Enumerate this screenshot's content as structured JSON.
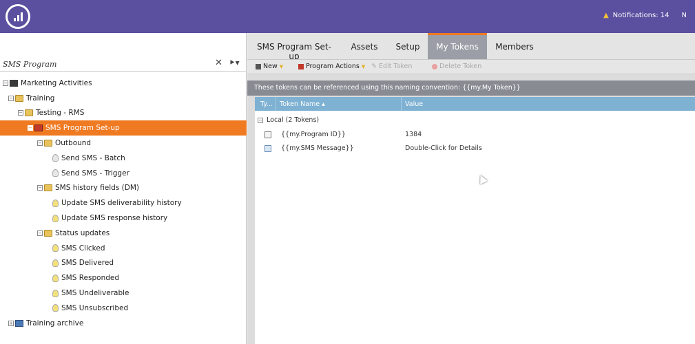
{
  "header": {
    "notifications_label": "Notifications: 14",
    "user_initial": "N",
    "brand_color": "#5b4fa0"
  },
  "left_panel": {
    "search": {
      "value": "SMS Program",
      "clear_glyph": "✕",
      "filter_glyph": "⯈▾"
    },
    "tree": [
      {
        "label": "Marketing Activities",
        "level": 0,
        "icon": "marketing-activities-icon",
        "expander": "−"
      },
      {
        "label": "Training",
        "level": 1,
        "icon": "folder-icon",
        "expander": "−"
      },
      {
        "label": "Testing - RMS",
        "level": 2,
        "icon": "folder-icon",
        "expander": "−"
      },
      {
        "label": "SMS Program Set-up",
        "level": 3,
        "icon": "program-icon",
        "expander": "−",
        "selected": true
      },
      {
        "label": "Outbound",
        "level": 4,
        "icon": "folder-icon",
        "expander": "−"
      },
      {
        "label": "Send SMS - Batch",
        "level": 5,
        "icon": "campaign-bulb-icon"
      },
      {
        "label": "Send SMS - Trigger",
        "level": 5,
        "icon": "campaign-bulb-icon"
      },
      {
        "label": "SMS history fields (DM)",
        "level": 4,
        "icon": "folder-icon",
        "expander": "−"
      },
      {
        "label": "Update SMS deliverability history",
        "level": 5,
        "icon": "campaign-bulb-icon"
      },
      {
        "label": "Update SMS response history",
        "level": 5,
        "icon": "campaign-bulb-icon"
      },
      {
        "label": "Status updates",
        "level": 4,
        "icon": "folder-icon",
        "expander": "−"
      },
      {
        "label": "SMS Clicked",
        "level": 5,
        "icon": "campaign-bulb-icon"
      },
      {
        "label": "SMS Delivered",
        "level": 5,
        "icon": "campaign-bulb-icon"
      },
      {
        "label": "SMS Responded",
        "level": 5,
        "icon": "campaign-bulb-icon"
      },
      {
        "label": "SMS Undeliverable",
        "level": 5,
        "icon": "campaign-bulb-icon"
      },
      {
        "label": "SMS Unsubscribed",
        "level": 5,
        "icon": "campaign-bulb-icon"
      },
      {
        "label": "Training archive",
        "level": 1,
        "icon": "archive-icon",
        "expander": "+"
      }
    ]
  },
  "tabs": [
    {
      "label": "SMS Program Set-up",
      "active": false
    },
    {
      "label": "Assets",
      "active": false
    },
    {
      "label": "Setup",
      "active": false
    },
    {
      "label": "My Tokens",
      "active": true
    },
    {
      "label": "Members",
      "active": false
    }
  ],
  "toolbar": {
    "new_label": "New",
    "program_actions_label": "Program Actions",
    "edit_token_label": "Edit Token",
    "delete_token_label": "Delete Token"
  },
  "info_bar": {
    "text": "These tokens can be referenced using this naming convention: {{my.My Token}}"
  },
  "grid": {
    "columns": {
      "type": "Ty...",
      "name": "Token Name",
      "sort_glyph": "▴",
      "value": "Value"
    },
    "group_label": "Local (2 Tokens)",
    "rows": [
      {
        "name": "{{my.Program ID}}",
        "value": "1384",
        "type": "number-token-icon"
      },
      {
        "name": "{{my.SMS Message}}",
        "value": "Double-Click for Details",
        "type": "rich-text-token-icon"
      }
    ]
  },
  "colors": {
    "accent_orange": "#ef7a22",
    "grid_header_blue": "#7eb1d2",
    "info_bar_grey": "#888b92"
  }
}
